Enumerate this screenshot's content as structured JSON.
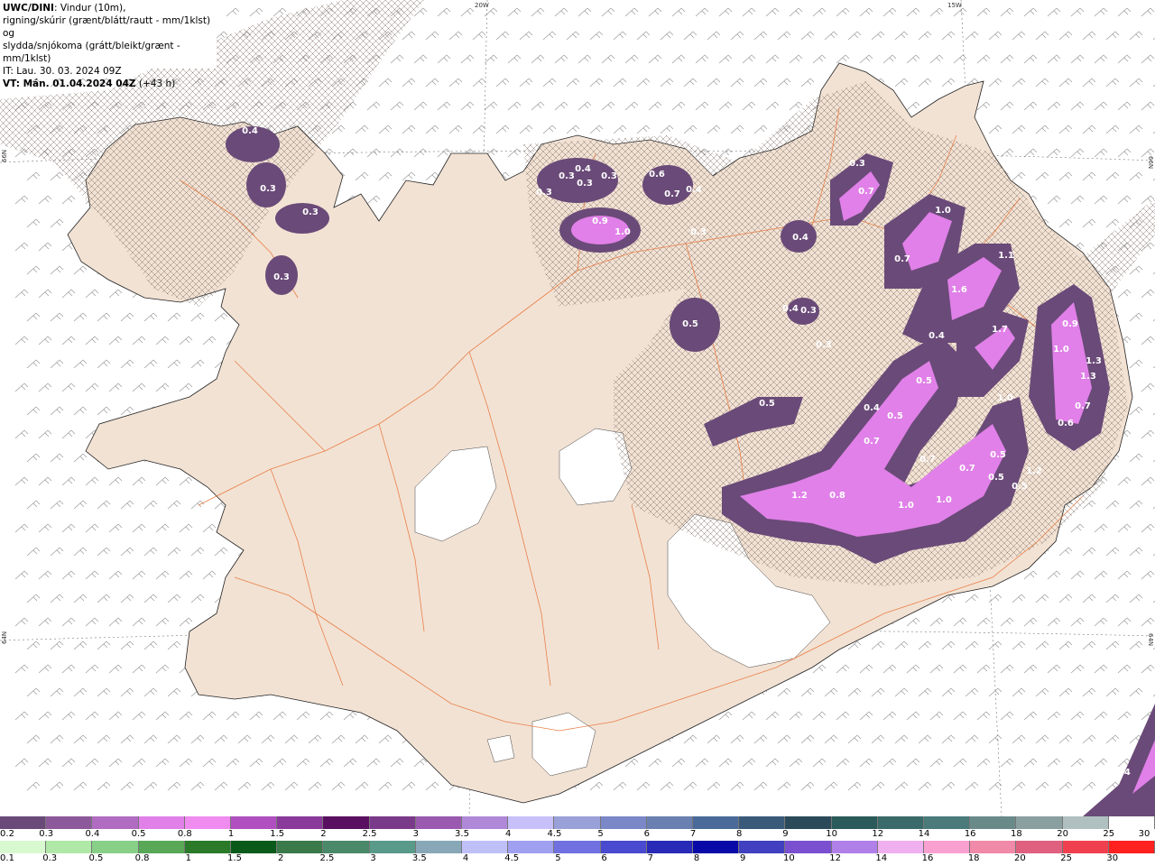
{
  "header": {
    "model": "UWC/DINI",
    "line1_rest": ": Vindur (10m),",
    "line2": "rigning/skúrir (grænt/blátt/rautt - mm/1klst) og",
    "line3": "slydda/snjókoma (grátt/bleikt/grænt - mm/1klst)",
    "issue_time": "IT: Lau. 30. 03. 2024 09Z",
    "valid_prefix": "VT: Mán. 01.04.2024 04Z",
    "valid_offset": " (+43 h)"
  },
  "grid_labels": {
    "top_20w": "20W",
    "top_15w": "15W",
    "left_66n": "66N",
    "right_66n": "66N",
    "left_64n": "64N",
    "right_64n": "64N"
  },
  "precip_labels": [
    "0.4",
    "0.3",
    "0.3",
    "0.3",
    "0.4",
    "0.3",
    "0.3",
    "0.3",
    "0.3",
    "0.9",
    "1.0",
    "0.6",
    "0.7",
    "0.4",
    "0.3",
    "0.3",
    "0.7",
    "1.0",
    "0.4",
    "0.7",
    "1.1",
    "1.6",
    "1.7",
    "0.5",
    "0.4",
    "0.3",
    "0.3",
    "0.4",
    "0.5",
    "1.0",
    "0.4",
    "0.5",
    "0.5",
    "0.7",
    "0.7",
    "0.7",
    "1.2",
    "0.8",
    "1.0",
    "1.0",
    "0.5",
    "0.5",
    "0.5",
    "1.2",
    "0.9",
    "1.0",
    "1.3",
    "1.3",
    "0.7",
    "0.6",
    "0.4"
  ],
  "legend": {
    "snow_colors": [
      "#6a4a78",
      "#8c5a9a",
      "#b06cc0",
      "#e080e8",
      "#f08cf0",
      "#b050c0",
      "#8a3a9a",
      "#5a1060",
      "#7a3a8a",
      "#9a5ab0",
      "#b088d8",
      "#c8c0f8",
      "#9aa0d8",
      "#7a88c8",
      "#6a80b0",
      "#4a6a9a",
      "#3a5a7a",
      "#2a4a5a",
      "#2a5a5a",
      "#3a6a6a",
      "#4a7a7a",
      "#6a8a8a",
      "#8aa0a0",
      "#b0c0c0",
      "#ffffff"
    ],
    "snow_ticks": [
      "0.2",
      "0.3",
      "0.4",
      "0.5",
      "0.8",
      "1",
      "1.5",
      "2",
      "2.5",
      "3",
      "3.5",
      "4",
      "4.5",
      "5",
      "6",
      "7",
      "8",
      "9",
      "10",
      "12",
      "14",
      "16",
      "18",
      "20",
      "25",
      "30"
    ],
    "rain_colors": [
      "#d8f8d0",
      "#b0e8a8",
      "#88d088",
      "#58a858",
      "#2a7a2a",
      "#0a5a1a",
      "#3a7a4a",
      "#4a8a6a",
      "#5a9a8a",
      "#88a8b8",
      "#c0c0f8",
      "#a0a0f0",
      "#7070e0",
      "#4a4ad0",
      "#2a2ab8",
      "#0a0aa8",
      "#4040c0",
      "#7a50d0",
      "#b080e8",
      "#f0b0f0",
      "#f8a0d0",
      "#f08aa8",
      "#e06080",
      "#f04050",
      "#ff2020"
    ],
    "rain_ticks": [
      "0.1",
      "0.3",
      "0.5",
      "0.8",
      "1",
      "1.5",
      "2",
      "2.5",
      "3",
      "3.5",
      "4",
      "4.5",
      "5",
      "6",
      "7",
      "8",
      "9",
      "10",
      "12",
      "14",
      "16",
      "18",
      "20",
      "25",
      "30"
    ]
  }
}
